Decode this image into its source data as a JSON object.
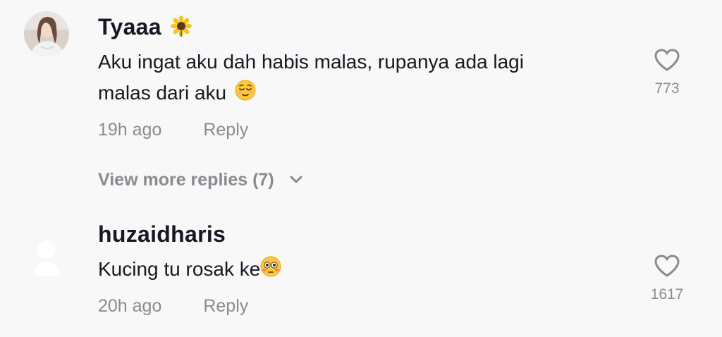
{
  "comments": [
    {
      "username": "Tyaaa",
      "username_emoji": "sunflower",
      "text_line1": "Aku ingat aku dah habis malas, rupanya ada lagi",
      "text_line2": "malas dari aku",
      "text_emoji": "relieved-face",
      "timestamp": "19h ago",
      "reply_label": "Reply",
      "like_count": "773",
      "view_more": "View more replies (7)"
    },
    {
      "username": "huzaidharis",
      "text": "Kucing tu rosak ke",
      "text_emoji": "flushed-face",
      "timestamp": "20h ago",
      "reply_label": "Reply",
      "like_count": "1617"
    }
  ],
  "colors": {
    "background": "#f8f8f8",
    "primary_text": "#161823",
    "secondary_text": "#8a8b91"
  }
}
